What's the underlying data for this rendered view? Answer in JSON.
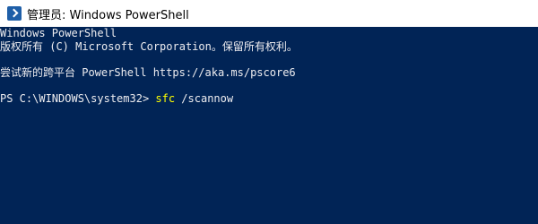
{
  "window": {
    "title": "管理员: Windows PowerShell"
  },
  "console": {
    "lines": [
      "Windows PowerShell",
      "版权所有 (C) Microsoft Corporation。保留所有权利。",
      "",
      "尝试新的跨平台 PowerShell https://aka.ms/pscore6",
      ""
    ],
    "prompt": "PS C:\\WINDOWS\\system32> ",
    "command": "sfc",
    "argument": " /scannow"
  },
  "colors": {
    "background": "#012456",
    "text": "#eeedf0",
    "command": "#ffff00",
    "titlebar": "#ffffff"
  },
  "icons": {
    "app": "powershell-icon"
  }
}
